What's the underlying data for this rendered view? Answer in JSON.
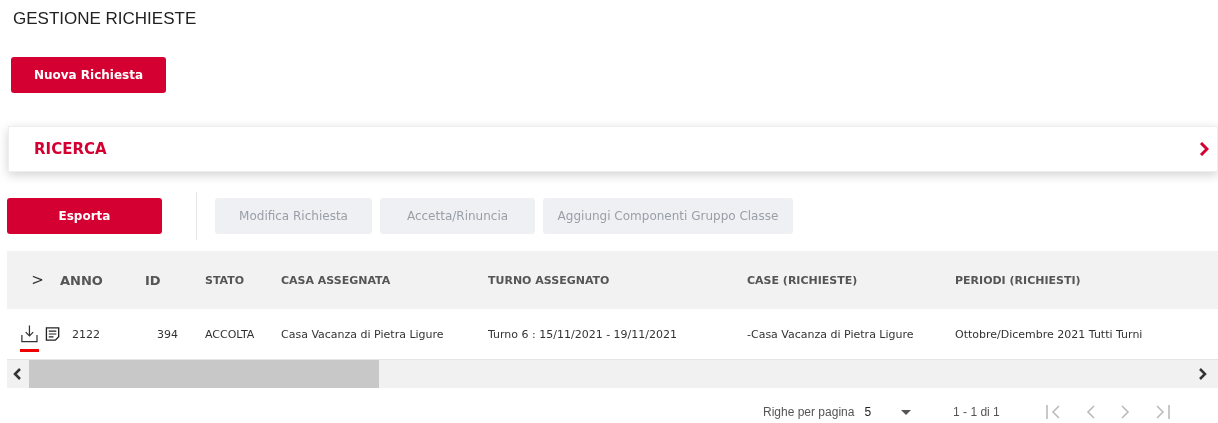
{
  "page_title": "GESTIONE RICHIESTE",
  "new_button": "Nuova Richiesta",
  "search_panel": {
    "title": "RICERCA",
    "expanded": false
  },
  "toolbar": [
    {
      "label": "Esporta",
      "disabled": false
    },
    {
      "label": "Modifica Richiesta",
      "disabled": true
    },
    {
      "label": "Accetta/Rinuncia",
      "disabled": true
    },
    {
      "label": "Aggiungi Componenti Gruppo Classe",
      "disabled": true
    }
  ],
  "table": {
    "expand_all": ">",
    "columns": [
      "ANNO",
      "ID",
      "STATO",
      "CASA ASSEGNATA",
      "TURNO ASSEGNATO",
      "CASE (RICHIESTE)",
      "PERIODI (RICHIESTI)"
    ],
    "rows": [
      {
        "download_selected": true,
        "cells": [
          "2122",
          "394",
          "ACCOLTA",
          "Casa Vacanza di Pietra Ligure",
          "Turno 6 : 15/11/2021 - 19/11/2021",
          "-Casa Vacanza di Pietra Ligure",
          "Ottobre/Dicembre 2021 Tutti Turni"
        ]
      }
    ]
  },
  "pagination": {
    "rows_label": "Righe per pagina",
    "rows_value": "5",
    "range": "1 - 1 di 1"
  }
}
